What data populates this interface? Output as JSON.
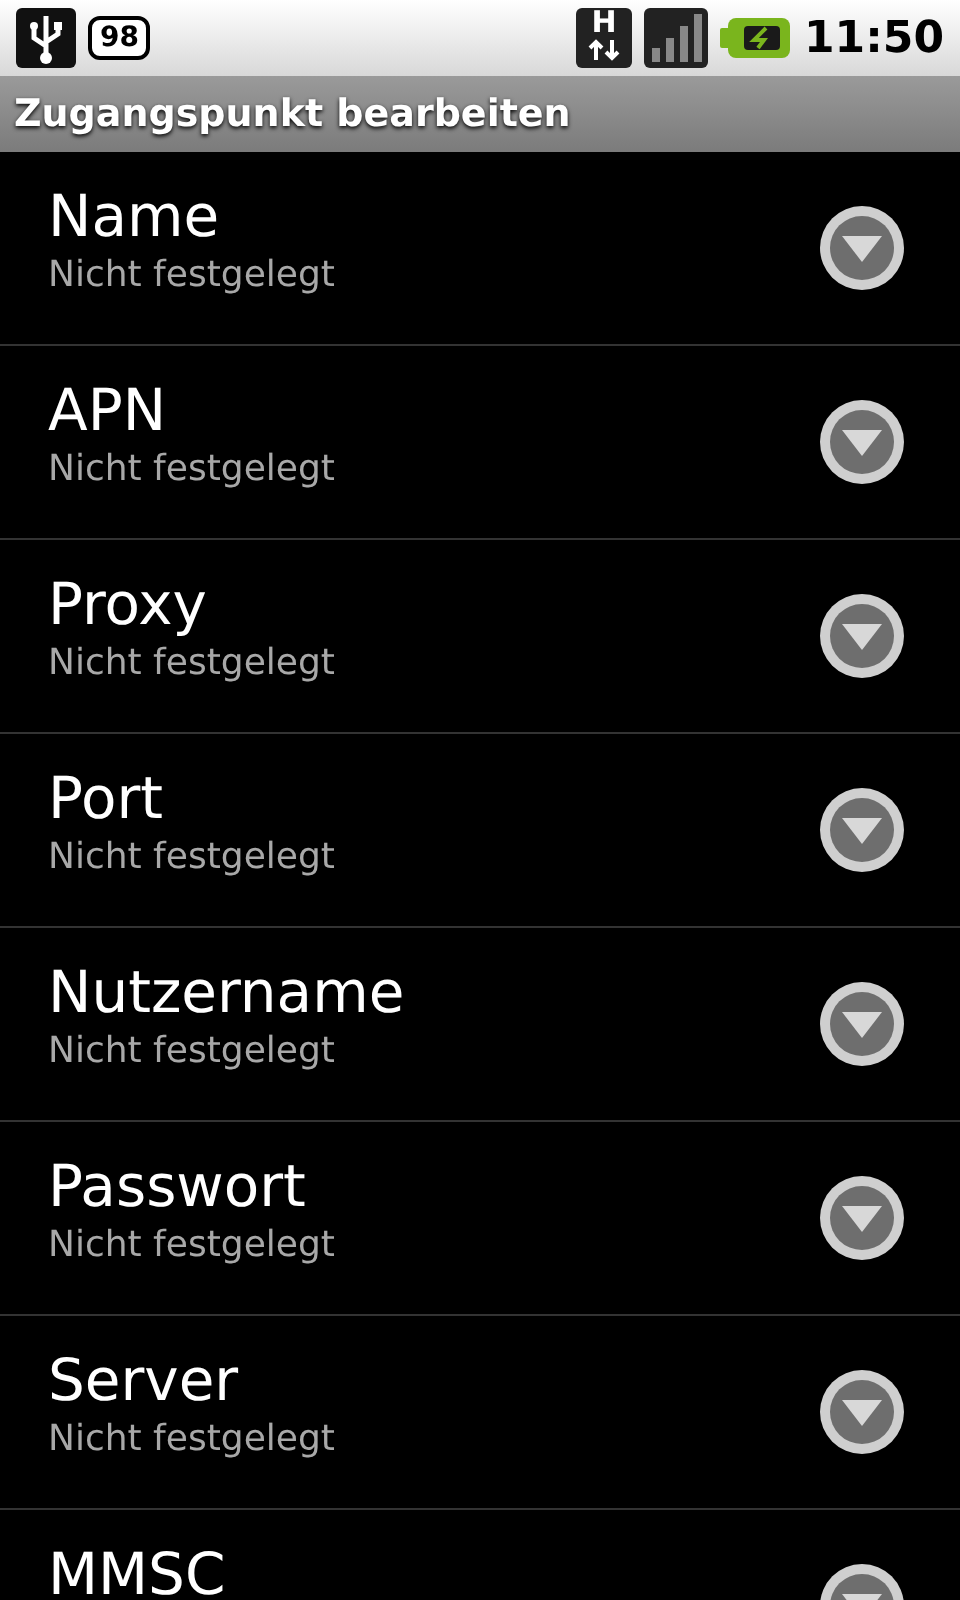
{
  "status_bar": {
    "notification_count": "98",
    "network_type": "H",
    "time": "11:50"
  },
  "title_bar": {
    "title": "Zugangspunkt bearbeiten"
  },
  "preferences": [
    {
      "title": "Name",
      "summary": "Nicht festgelegt"
    },
    {
      "title": "APN",
      "summary": "Nicht festgelegt"
    },
    {
      "title": "Proxy",
      "summary": "Nicht festgelegt"
    },
    {
      "title": "Port",
      "summary": "Nicht festgelegt"
    },
    {
      "title": "Nutzername",
      "summary": "Nicht festgelegt"
    },
    {
      "title": "Passwort",
      "summary": "Nicht festgelegt"
    },
    {
      "title": "Server",
      "summary": "Nicht festgelegt"
    },
    {
      "title": "MMSC"
    }
  ]
}
